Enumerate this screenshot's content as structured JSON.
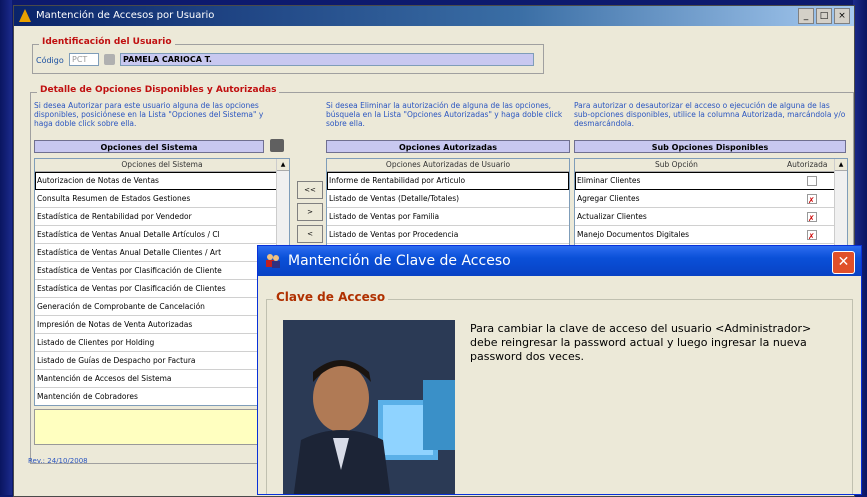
{
  "main_window": {
    "title": "Mantención de Accesos por Usuario",
    "ident_legend": "Identificación del Usuario",
    "codigo_label": "Código",
    "codigo_value": "PCT",
    "user_name": "PAMELA CARIOCA T.",
    "detalle_legend": "Detalle de Opciones Disponibles y Autorizadas",
    "hint_sistema": "Si desea Autorizar para este usuario alguna de las opciones disponibles, posiciónese en la Lista \"Opciones del Sistema\" y haga doble click sobre ella.",
    "hint_autorizadas": "Si desea Eliminar la autorización de alguna de las opciones, búsquela en la Lista \"Opciones Autorizadas\" y haga doble click sobre ella.",
    "hint_subopciones": "Para autorizar o desautorizar el acceso o ejecución de alguna de las sub-opciones disponibles, utilice la columna Autorizada, marcándola y/o desmarcándola.",
    "sistema": {
      "header": "Opciones del Sistema",
      "column": "Opciones del Sistema",
      "items": [
        "Autorizacion de Notas de Ventas",
        "Consulta Resumen de Estados Gestiones",
        "Estadística de Rentabilidad por Vendedor",
        "Estadística de Ventas Anual Detalle Artículos / Cl",
        "Estadística de Ventas Anual Detalle Clientes / Art",
        "Estadística de Ventas por Clasificación de Cliente",
        "Estadística de Ventas por Clasificación de Clientes",
        "Generación de Comprobante de Cancelación",
        "Impresión de Notas de Venta Autorizadas",
        "Listado de Clientes por Holding",
        "Listado de Guías de Despacho por Factura",
        "Mantención de Accesos del Sistema",
        "Mantención de Cobradores"
      ]
    },
    "move_buttons": [
      "<<",
      ">",
      "<"
    ],
    "autorizadas": {
      "header": "Opciones Autorizadas",
      "column": "Opciones Autorizadas de Usuario",
      "items": [
        "Informe de Rentabilidad por Articulo",
        "Listado de Ventas (Detalle/Totales)",
        "Listado de Ventas por Familia",
        "Listado de Ventas por Procedencia"
      ]
    },
    "subopciones": {
      "header": "Sub Opciones Disponibles",
      "column": "Sub Opción",
      "column2": "Autorizada",
      "items": [
        {
          "label": "Eliminar Clientes",
          "checked": false
        },
        {
          "label": "Agregar Clientes",
          "checked": true
        },
        {
          "label": "Actualizar Clientes",
          "checked": true
        },
        {
          "label": "Manejo Documentos Digitales",
          "checked": true
        }
      ]
    },
    "revision": "Rev.: 24/10/2008"
  },
  "dialog": {
    "title": "Mantención de Clave de Acceso",
    "close": "✕",
    "group_legend": "Clave de Acceso",
    "message": "Para cambiar la clave de acceso del usuario <Administrador> debe reingresar la password actual y luego ingresar la nueva password dos veces."
  },
  "colors": {
    "desktop": "#0d1a6e",
    "xp_title_blue": "#0a50d8",
    "legend_red": "#c01010",
    "hint_blue": "#2a55c0"
  }
}
